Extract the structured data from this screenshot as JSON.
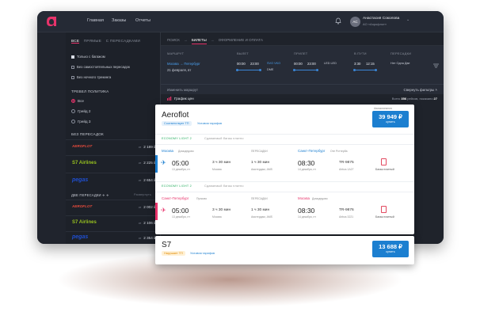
{
  "nav": {
    "home": "Главная",
    "orders": "Заказы",
    "reports": "Отчеты"
  },
  "user": {
    "initials": "АС",
    "name": "Анастасия Соколова",
    "email": "АО «Аэрофлот»"
  },
  "sidebar": {
    "tabs": [
      "ВСЕ",
      "ПРЯМЫЕ",
      "С ПЕРЕСАДКАМИ"
    ],
    "checkboxes": [
      {
        "label": "Только с багажом",
        "checked": true
      },
      {
        "label": "Без самостоятельных пересадок",
        "checked": false
      },
      {
        "label": "Без ночного трекинга",
        "checked": false
      }
    ],
    "policy_title": "ТРЕВЕЛ ПОЛИТИКА",
    "radios": [
      {
        "label": "Все",
        "checked": true
      },
      {
        "label": "Грейд 2",
        "checked": false
      },
      {
        "label": "Грейд 3",
        "checked": false
      }
    ],
    "no_transfer_title": "БЕЗ ПЕРЕСАДОК",
    "group1": [
      {
        "airline": "AEROFLOT",
        "from": "от",
        "price": "2 189 ₽"
      },
      {
        "airline": "S7 Airlines",
        "from": "от",
        "price": "2 225 ₽"
      },
      {
        "airline": "pegas",
        "from": "от",
        "price": "2 654 ₽"
      }
    ],
    "two_transfer_title": "ДВЕ ПЕРЕСАДКИ ✈ ✈",
    "two_transfer_action": "Развернуть",
    "group2": [
      {
        "airline": "AEROFLOT",
        "from": "от",
        "price": "2 002 ₽"
      },
      {
        "airline": "S7 Airlines",
        "from": "от",
        "price": "2 106 ₽"
      },
      {
        "airline": "pegas",
        "from": "от",
        "price": "2 354 ₽"
      }
    ]
  },
  "crumbs": [
    "ПОИСК",
    "→",
    "БИЛЕТЫ",
    "→",
    "ОФОРМЛЕНИЕ И ОПЛАТА"
  ],
  "filters": {
    "route_label": "МАРШРУТ",
    "route_value": "Москва → Петербург",
    "route_date": "21 февраля, вт",
    "depart_label": "ВЫЛЕТ",
    "depart_from": "00:00",
    "depart_to": "23:00",
    "depart_codes": "SVO  VKO",
    "depart_code2": "DME",
    "arrive_label": "ПРИЛЕТ",
    "arrive_from": "00:00",
    "arrive_to": "23:00",
    "arrive_codes": "LED  LED",
    "intransit_label": "В ПУТИ",
    "intransit_from": "3:30",
    "intransit_to": "12:15",
    "transfers_label": "ПЕРЕСАДКИ",
    "transfers_value": "Нет  Одна  Две"
  },
  "subbar": {
    "change": "Изменить маршрут",
    "collapse": "Свернуть фильтры"
  },
  "chart": {
    "link": "График цен",
    "found_prefix": "Всего",
    "found_count": "356",
    "found_mid": "рейсов, показано",
    "found_shown": "27"
  },
  "card1": {
    "airline": "Aeroflot",
    "compliance": "Соответствует ТП",
    "tariff": "Условия тарифов",
    "price_hint": "Авиакомпания",
    "price": "39 949 ₽",
    "buy": "купить",
    "seg1": {
      "fare": "ECONOMY LIGHT 2",
      "fare_note": "Сдаваемый багаж платно",
      "from_city": "Москва",
      "from_airport": "Домодедово",
      "transfer_label": "ПЕРЕСАДКИ",
      "to_city": "Санкт-Петербург",
      "to_airport": "Оте Рсттерба",
      "dep_time": "05:00",
      "dep_date": "13 декабря, пт",
      "duration": "3 ч 30 мин",
      "duration_note": "Москва",
      "transfer_time": "1 ч 30 мин",
      "transfer_place": "Амстердам, AMS",
      "arr_time": "08:30",
      "arr_date": "14 декабря, пт",
      "flight": "TR-9875",
      "aircraft": "Airbus 1A27",
      "baggage": "Багаж платный"
    },
    "seg2": {
      "fare": "ECONOMY LIGHT 2",
      "fare_note": "Сдаваемый багаж платно",
      "from_city": "Санкт-Петербург",
      "from_airport": "Пулково",
      "transfer_label": "ПЕРЕСАДКИ",
      "to_city": "Москва",
      "to_airport": "Домодедово",
      "dep_time": "05:00",
      "dep_date": "13 декабря, пт",
      "duration": "3 ч 30 мин",
      "duration_note": "Москва",
      "transfer_time": "1 ч 30 мин",
      "transfer_place": "Амстердам, AMS",
      "arr_time": "08:30",
      "arr_date": "14 декабря, пт",
      "flight": "TR-9876",
      "aircraft": "Airbus 3221",
      "baggage": "Багаж платный"
    }
  },
  "card2": {
    "airline": "S7",
    "compliance": "Нарушает ТП",
    "tariff": "Условия тарифов",
    "price": "13 688 ₽",
    "buy": "купить"
  },
  "colors": {
    "accent": "#e8336b",
    "blue": "#1c7fd0",
    "green": "#27ae60"
  }
}
